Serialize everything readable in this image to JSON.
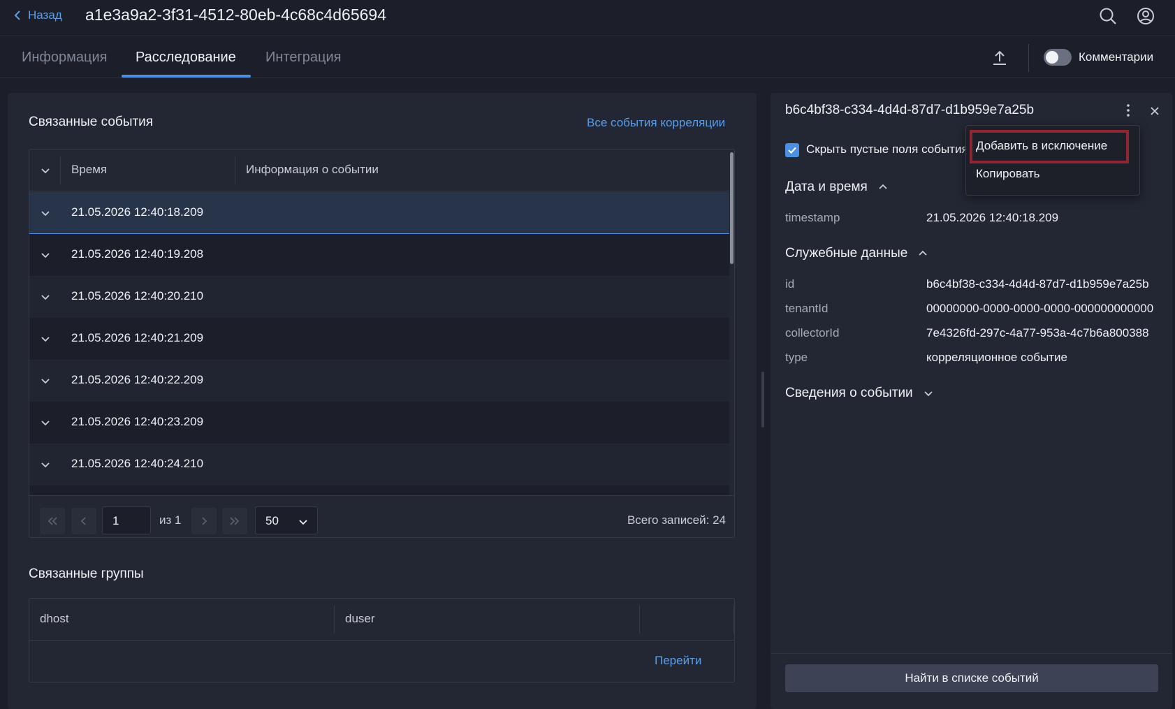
{
  "header": {
    "back_label": "Назад",
    "title": "a1e3a9a2-3f31-4512-80eb-4c68c4d65694",
    "icons": [
      "search-icon",
      "user-account-icon"
    ]
  },
  "tabs": [
    {
      "label": "Информация",
      "active": false
    },
    {
      "label": "Расследование",
      "active": true
    },
    {
      "label": "Интеграция",
      "active": false
    }
  ],
  "toolbar": {
    "export_icon": "upload-icon",
    "comments_label": "Комментарии",
    "comments_enabled": false
  },
  "related_events": {
    "title": "Связанные события",
    "all_link": "Все события корреляции",
    "columns": [
      "Время",
      "Информация о событии"
    ],
    "rows": [
      "21.05.2026 12:40:18.209",
      "21.05.2026 12:40:19.208",
      "21.05.2026 12:40:20.210",
      "21.05.2026 12:40:21.209",
      "21.05.2026 12:40:22.209",
      "21.05.2026 12:40:23.209",
      "21.05.2026 12:40:24.210"
    ],
    "pagination": {
      "page": "1",
      "of_label": "из 1",
      "page_size": "50",
      "total_label": "Всего записей: 24"
    }
  },
  "related_groups": {
    "title": "Связанные группы",
    "columns": [
      "dhost",
      "duser"
    ],
    "go_link": "Перейти"
  },
  "details": {
    "title": "b6c4bf38-c334-4d4d-87d7-d1b959e7a25b",
    "hide_empty_label": "Скрыть пустые поля события",
    "hide_empty_checked": true,
    "sections": {
      "datetime": {
        "title": "Дата и время",
        "rows": [
          {
            "key": "timestamp",
            "value": "21.05.2026 12:40:18.209"
          }
        ]
      },
      "service": {
        "title": "Служебные данные",
        "rows": [
          {
            "key": "id",
            "value": "b6c4bf38-c334-4d4d-87d7-d1b959e7a25b"
          },
          {
            "key": "tenantId",
            "value": "00000000-0000-0000-0000-000000000000"
          },
          {
            "key": "collectorId",
            "value": "7e4326fd-297c-4a77-953a-4c7b6a800388"
          },
          {
            "key": "type",
            "value": "корреляционное событие"
          }
        ]
      },
      "event_info": {
        "title": "Сведения о событии"
      }
    },
    "find_button": "Найти в списке событий"
  },
  "context_menu": {
    "items": [
      "Добавить в исключение",
      "Копировать"
    ],
    "highlight_color": "#8e2633"
  },
  "colors": {
    "accent": "#4c8fe3",
    "link": "#5c9ee8",
    "background": "#1c1f29",
    "panel": "#232734"
  }
}
